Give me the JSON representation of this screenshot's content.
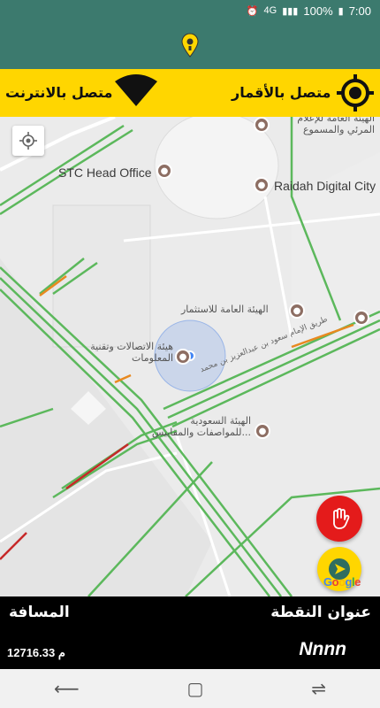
{
  "status_bar": {
    "time": "7:00",
    "battery": "100%",
    "network": "4G"
  },
  "app_bar": {
    "logo_icon": "yellow-pin-logo-icon"
  },
  "connection_bar": {
    "satellite_status": "متصل بالأقمار",
    "internet_status": "متصل بالانترنت",
    "satellite_icon": "gps-target-icon",
    "internet_icon": "wifi-signal-icon"
  },
  "map": {
    "labels": {
      "stc": "STC Head Office",
      "raidah": "Raidah Digital City",
      "media_authority": "الهيئة العامة للإعلام المرئي والمسموع",
      "investment_authority": "الهيئة العامة للاستثمار",
      "comm_authority": "هيئة الاتصالات وتقنية المعلومات",
      "standards_authority": "الهيئة السعودية للمواصفات والمقاييس...",
      "road_name": "طريق الإمام سعود بن عبدالعزيز بن محمد"
    },
    "google_logo": "Google"
  },
  "info_panel": {
    "point_title": "عنوان النقطة",
    "distance_title": "المسافة",
    "point_value": "Nnnn",
    "distance_value": "12716.33 م"
  },
  "colors": {
    "header": "#3c7a6e",
    "accent_yellow": "#ffd600",
    "stop_red": "#e41b1b",
    "road_green": "#5cb85c",
    "road_red": "#c62828"
  }
}
